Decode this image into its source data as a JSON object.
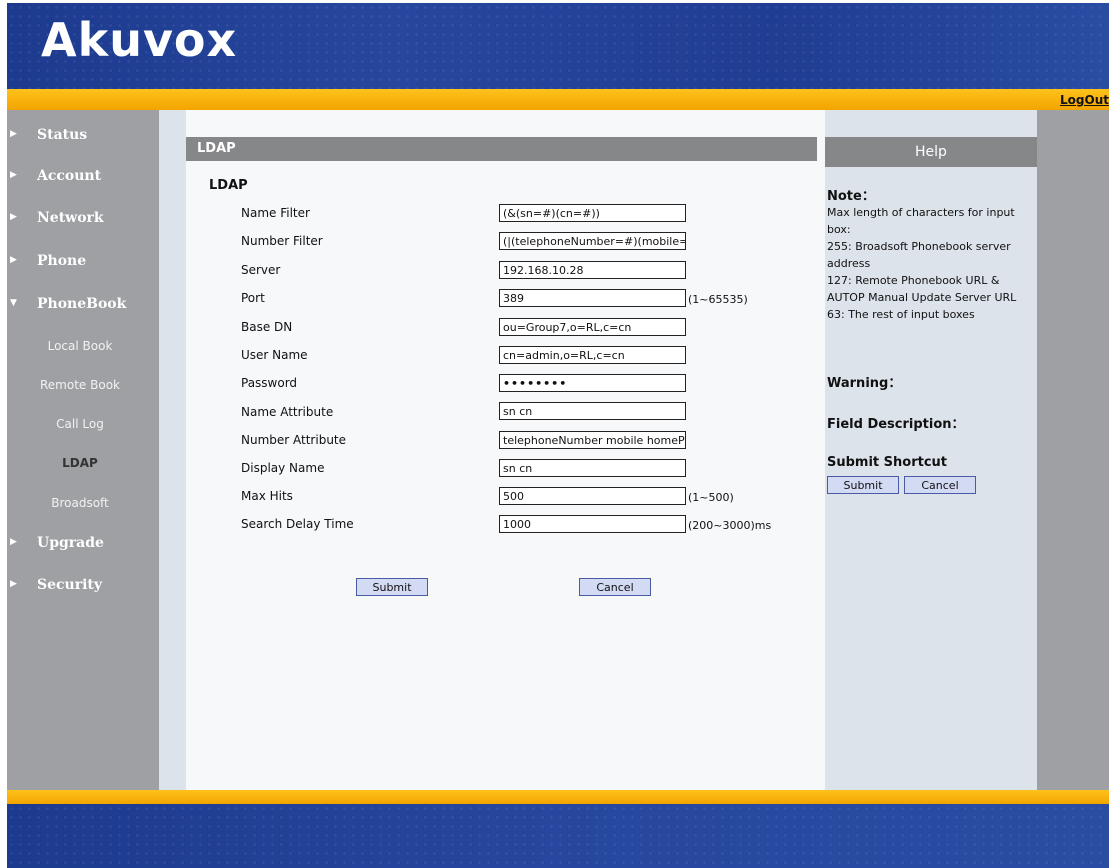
{
  "brand": {
    "logo": "Akuvox"
  },
  "header": {
    "logout_label": "LogOut"
  },
  "sidebar": {
    "items": [
      {
        "label": "Status"
      },
      {
        "label": "Account"
      },
      {
        "label": "Network"
      },
      {
        "label": "Phone"
      },
      {
        "label": "PhoneBook"
      },
      {
        "label": "Upgrade"
      },
      {
        "label": "Security"
      }
    ],
    "phonebook_sub": [
      {
        "label": "Local Book"
      },
      {
        "label": "Remote Book"
      },
      {
        "label": "Call Log"
      },
      {
        "label": "LDAP",
        "active": true
      },
      {
        "label": "Broadsoft"
      }
    ]
  },
  "main": {
    "title": "LDAP",
    "section_title": "LDAP",
    "fields": [
      {
        "label": "Name Filter",
        "value": "(&(sn=#)(cn=#))"
      },
      {
        "label": "Number Filter",
        "value": "(|(telephoneNumber=#)(mobile="
      },
      {
        "label": "Server",
        "value": "192.168.10.28"
      },
      {
        "label": "Port",
        "value": "389",
        "range": "(1~65535)"
      },
      {
        "label": "Base DN",
        "value": "ou=Group7,o=RL,c=cn"
      },
      {
        "label": "User Name",
        "value": "cn=admin,o=RL,c=cn"
      },
      {
        "label": "Password",
        "value": "••••••••"
      },
      {
        "label": "Name Attribute",
        "value": "sn cn"
      },
      {
        "label": "Number Attribute",
        "value": "telephoneNumber mobile homeP"
      },
      {
        "label": "Display Name",
        "value": "sn cn"
      },
      {
        "label": "Max Hits",
        "value": "500",
        "range": "(1~500)"
      },
      {
        "label": "Search Delay Time",
        "value": "1000",
        "range": "(200~3000)ms"
      }
    ],
    "submit_label": "Submit",
    "cancel_label": "Cancel"
  },
  "help": {
    "title": "Help",
    "note_head": "Note：",
    "note_lines": [
      "Max length of characters for input",
      "box:",
      "255: Broadsoft Phonebook server",
      "address",
      "127: Remote Phonebook URL &",
      "AUTOP Manual Update Server URL",
      "63: The rest of input boxes"
    ],
    "warning_head": "Warning：",
    "field_desc_head": "Field Description：",
    "shortcut_head": "Submit Shortcut",
    "submit_label": "Submit",
    "cancel_label": "Cancel"
  }
}
